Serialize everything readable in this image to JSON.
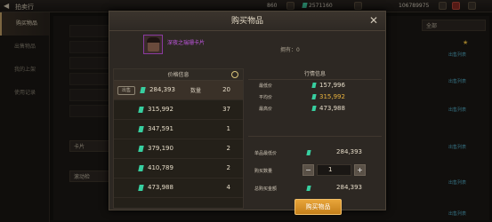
{
  "topbar": {
    "back_icon": "back-arrow-icon",
    "title": "拍卖行",
    "res1": "860",
    "res2": "2571160",
    "res3": "106789975"
  },
  "sidebar": {
    "items": [
      {
        "label": "购买物品",
        "active": true
      },
      {
        "label": "出售物品",
        "active": false
      },
      {
        "label": "我的上架",
        "active": false
      },
      {
        "label": "使用记录",
        "active": false
      }
    ]
  },
  "background": {
    "dropdown_text": "全部",
    "list_label": "出售列表",
    "card_label": "卡片",
    "retrieve_label": "滚动检"
  },
  "modal": {
    "title": "购买物品",
    "item_name": "深夜之瑞珊卡片",
    "owned_label": "拥有：",
    "owned_count": "0",
    "price_info_label": "价格信息",
    "sale_tag": "出售",
    "qty_label": "数量",
    "price_rows": [
      {
        "price": "284,393",
        "qty": "20"
      },
      {
        "price": "315,992",
        "qty": "37"
      },
      {
        "price": "347,591",
        "qty": "1"
      },
      {
        "price": "379,190",
        "qty": "2"
      },
      {
        "price": "410,789",
        "qty": "2"
      },
      {
        "price": "473,988",
        "qty": "4"
      }
    ],
    "market_info_title": "行情信息",
    "stats": [
      {
        "label": "最低价",
        "value": "157,996",
        "color": "#e6dcc8"
      },
      {
        "label": "平均价",
        "value": "315,992",
        "color": "#e8b23e"
      },
      {
        "label": "最高价",
        "value": "473,988",
        "color": "#e6dcc8"
      }
    ],
    "unit_price_label": "单品最低价",
    "unit_price": "284,393",
    "buy_qty_label": "购买数量",
    "buy_qty": "1",
    "total_label": "总购买金额",
    "total": "284,393",
    "buy_button": "购买物品"
  }
}
